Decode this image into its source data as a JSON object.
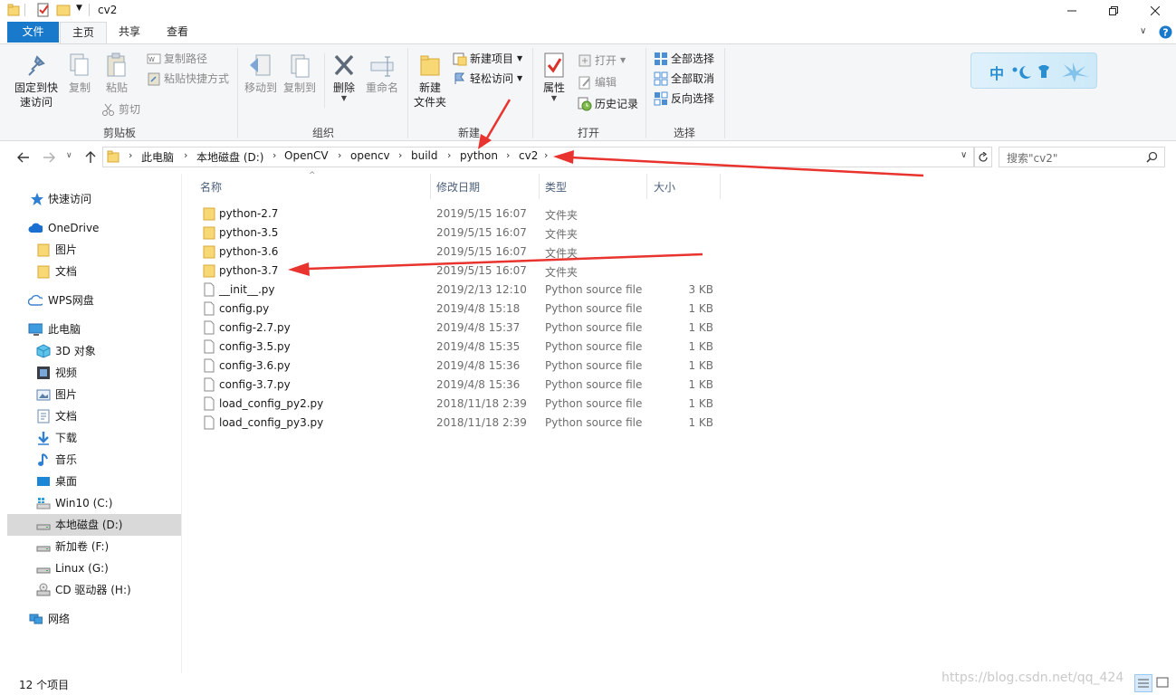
{
  "window": {
    "title": "cv2"
  },
  "tabs": {
    "file": "文件",
    "home": "主页",
    "share": "共享",
    "view": "查看"
  },
  "ribbon": {
    "clipboard": {
      "pin": "固定到快\n速访问",
      "copy": "复制",
      "paste": "粘贴",
      "copy_path": "复制路径",
      "paste_shortcut": "粘贴快捷方式",
      "cut": "剪切",
      "label": "剪贴板"
    },
    "organize": {
      "move_to": "移动到",
      "copy_to": "复制到",
      "delete": "删除",
      "rename": "重命名",
      "label": "组织"
    },
    "new": {
      "new_folder": "新建\n文件夹",
      "new_item": "新建项目",
      "easy_access": "轻松访问",
      "label": "新建"
    },
    "open": {
      "properties": "属性",
      "open": "打开",
      "edit": "编辑",
      "history": "历史记录",
      "label": "打开"
    },
    "select": {
      "select_all": "全部选择",
      "select_none": "全部取消",
      "invert": "反向选择",
      "label": "选择"
    },
    "logo_text": "中"
  },
  "address": {
    "crumbs": [
      "此电脑",
      "本地磁盘 (D:)",
      "OpenCV",
      "opencv",
      "build",
      "python",
      "cv2"
    ],
    "search_placeholder": "搜索\"cv2\""
  },
  "nav": {
    "quick_access": "快速访问",
    "onedrive": "OneDrive",
    "od_pictures": "图片",
    "od_documents": "文档",
    "wps": "WPS网盘",
    "this_pc": "此电脑",
    "objects3d": "3D 对象",
    "videos": "视频",
    "pictures": "图片",
    "documents": "文档",
    "downloads": "下载",
    "music": "音乐",
    "desktop": "桌面",
    "drive_c": "Win10 (C:)",
    "drive_d": "本地磁盘 (D:)",
    "drive_f": "新加卷 (F:)",
    "drive_g": "Linux (G:)",
    "drive_h": "CD 驱动器 (H:)",
    "network": "网络"
  },
  "columns": {
    "name": "名称",
    "date": "修改日期",
    "type": "类型",
    "size": "大小"
  },
  "files": [
    {
      "name": "python-2.7",
      "date": "2019/5/15 16:07",
      "type": "文件夹",
      "size": "",
      "kind": "folder"
    },
    {
      "name": "python-3.5",
      "date": "2019/5/15 16:07",
      "type": "文件夹",
      "size": "",
      "kind": "folder"
    },
    {
      "name": "python-3.6",
      "date": "2019/5/15 16:07",
      "type": "文件夹",
      "size": "",
      "kind": "folder"
    },
    {
      "name": "python-3.7",
      "date": "2019/5/15 16:07",
      "type": "文件夹",
      "size": "",
      "kind": "folder"
    },
    {
      "name": "__init__.py",
      "date": "2019/2/13 12:10",
      "type": "Python source file",
      "size": "3 KB",
      "kind": "file"
    },
    {
      "name": "config.py",
      "date": "2019/4/8 15:18",
      "type": "Python source file",
      "size": "1 KB",
      "kind": "file"
    },
    {
      "name": "config-2.7.py",
      "date": "2019/4/8 15:37",
      "type": "Python source file",
      "size": "1 KB",
      "kind": "file"
    },
    {
      "name": "config-3.5.py",
      "date": "2019/4/8 15:35",
      "type": "Python source file",
      "size": "1 KB",
      "kind": "file"
    },
    {
      "name": "config-3.6.py",
      "date": "2019/4/8 15:36",
      "type": "Python source file",
      "size": "1 KB",
      "kind": "file"
    },
    {
      "name": "config-3.7.py",
      "date": "2019/4/8 15:36",
      "type": "Python source file",
      "size": "1 KB",
      "kind": "file"
    },
    {
      "name": "load_config_py2.py",
      "date": "2018/11/18 2:39",
      "type": "Python source file",
      "size": "1 KB",
      "kind": "file"
    },
    {
      "name": "load_config_py3.py",
      "date": "2018/11/18 2:39",
      "type": "Python source file",
      "size": "1 KB",
      "kind": "file"
    }
  ],
  "status": {
    "count": "12 个项目"
  },
  "watermark": "https://blog.csdn.net/qq_424",
  "colors": {
    "accent": "#1979ca",
    "folder": "#f8d775",
    "annotation": "#e8332e",
    "selected": "#cce8ff"
  }
}
